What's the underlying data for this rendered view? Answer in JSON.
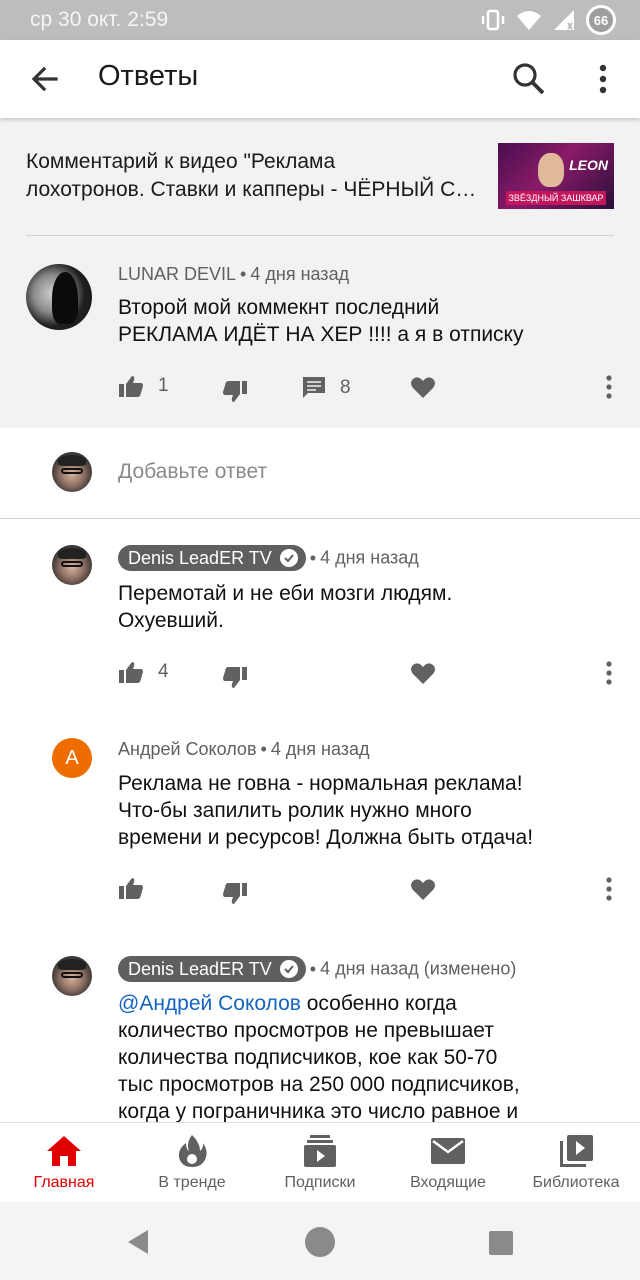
{
  "status_bar": {
    "time": "ср 30 окт. 2:59",
    "battery": "66"
  },
  "app_bar": {
    "title": "Ответы"
  },
  "video": {
    "line1": "Комментарий к видео \"Реклама",
    "line2": "лохотронов. Ставки и капперы - ЧЁРНЫЙ СПИСОК"
  },
  "thumbnail": {
    "brand": "LEON",
    "caption": "ЗВЁЗДНЫЙ ЗАШКВАР"
  },
  "main_comment": {
    "author": "LUNAR DEVIL",
    "time": "4 дня назад",
    "text_line1": "Второй мой коммекнт последний",
    "text_line2": "РЕКЛАМА ИДЁТ НА ХЕР !!!! а я в отписку",
    "likes": "1",
    "replies": "8"
  },
  "add_reply_placeholder": "Добавьте ответ",
  "replies": [
    {
      "author": "Denis LeadER TV",
      "time": "4 дня назад",
      "line1": "Перемотай и не еби мозги людям.",
      "line2": "Охуевший.",
      "likes": "4"
    },
    {
      "author": "Андрей Соколов",
      "avatar_letter": "А",
      "time": "4 дня назад",
      "line1": "Реклама не говна - нормальная реклама!",
      "line2": "Что-бы запилить ролик нужно много",
      "line3": "времени и ресурсов! Должна быть отдача!"
    },
    {
      "author": "Denis LeadER TV",
      "time": "4 дня назад (изменено)",
      "mention": "@Андрей Соколов",
      "line1_rest": " особенно когда",
      "line2": "количество просмотров не превышает",
      "line3": "количества подписчиков, кое как 50-70",
      "line4": "тыс просмотров на 250 000 подписчиков,",
      "line5": "когда у пограничника это число равное и"
    }
  ],
  "bottom_nav": [
    {
      "label": "Главная",
      "icon": "home-icon",
      "active": true
    },
    {
      "label": "В тренде",
      "icon": "flame-icon"
    },
    {
      "label": "Подписки",
      "icon": "subscriptions-icon"
    },
    {
      "label": "Входящие",
      "icon": "mail-icon"
    },
    {
      "label": "Библиотека",
      "icon": "library-icon"
    }
  ],
  "colors": {
    "accent": "#e00000",
    "mention": "#1565c0",
    "chip": "#5f5f5f",
    "header_bg": "#f2f2f2"
  }
}
